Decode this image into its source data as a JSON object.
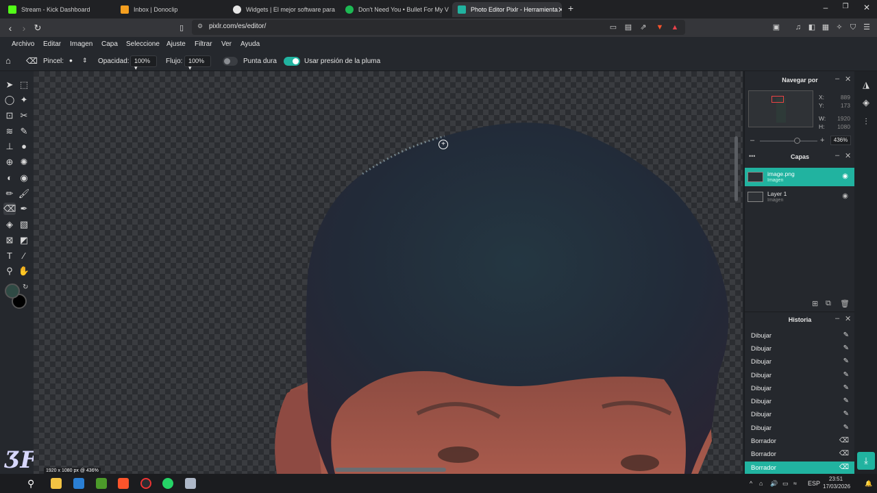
{
  "browser": {
    "tabs": [
      {
        "title": "Stream - Kick Dashboard",
        "color": "#53fc18"
      },
      {
        "title": "Inbox | Donoclip",
        "color": "#f59f1f"
      },
      {
        "title": "Widgets | El mejor software para pot",
        "color": "#e6e6e6"
      },
      {
        "title": "Don't Need You • Bullet For My V",
        "color": "#1db954"
      },
      {
        "title": "Photo Editor Pixlr - Herramienta",
        "color": "#21b3a0"
      }
    ],
    "new_tab": "+",
    "url": "pixlr.com/es/editor/"
  },
  "menu": [
    "Archivo",
    "Editar",
    "Imagen",
    "Capa",
    "Seleccione",
    "Ajuste",
    "Filtrar",
    "Ver",
    "Ayuda"
  ],
  "tool_options": {
    "brush_label": "Pincel:",
    "opacity_label": "Opacidad:",
    "opacity_value": "100%",
    "flow_label": "Flujo:",
    "flow_value": "100%",
    "hard_tip_label": "Punta dura",
    "pen_pressure_label": "Usar presión de la pluma"
  },
  "navigator": {
    "title": "Navegar por",
    "x_label": "X:",
    "x_value": "889",
    "y_label": "Y:",
    "y_value": "173",
    "w_label": "W:",
    "w_value": "1920",
    "h_label": "H:",
    "h_value": "1080",
    "zoom": "436%"
  },
  "layers": {
    "title": "Capas",
    "items": [
      {
        "name": "image.png",
        "type": "Imagen",
        "selected": true
      },
      {
        "name": "Layer 1",
        "type": "Imagen",
        "selected": false
      }
    ]
  },
  "history": {
    "title": "Historia",
    "items": [
      "Dibujar",
      "Dibujar",
      "Dibujar",
      "Dibujar",
      "Dibujar",
      "Dibujar",
      "Dibujar",
      "Dibujar",
      "Borrador",
      "Borrador",
      "Borrador"
    ]
  },
  "status": {
    "dims_a": "1920",
    "dims_sep": "x",
    "dims_b": "1080",
    "dims_suffix": "px @ 436%"
  },
  "taskbar": {
    "time": "23:51",
    "date": "17/03/2026",
    "lang": "ESP"
  },
  "colors": {
    "accent": "#21b3a0",
    "foreground": "#2f4a44",
    "background": "#000000"
  }
}
